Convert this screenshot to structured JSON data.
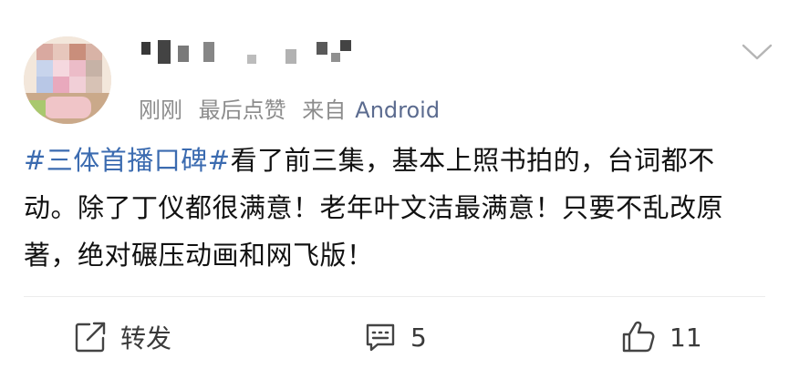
{
  "post": {
    "meta": {
      "time": "刚刚",
      "last_like": "最后点赞",
      "source_prefix": "来自",
      "source": "Android"
    },
    "content": {
      "topic": "#三体首播口碑#",
      "text": "看了前三集，基本上照书拍的，台词都不动。除了丁仪都很满意！老年叶文洁最满意！只要不乱改原著，绝对碾压动画和网飞版！"
    },
    "actions": {
      "repost_label": "转发",
      "comment_count": "5",
      "like_count": "11"
    },
    "colors": {
      "topic": "#3b6bb0",
      "meta": "#8c8c8c",
      "source": "#5b6b8f"
    },
    "icons": [
      "repost-icon",
      "comment-icon",
      "like-icon",
      "chevron-down-icon"
    ]
  }
}
